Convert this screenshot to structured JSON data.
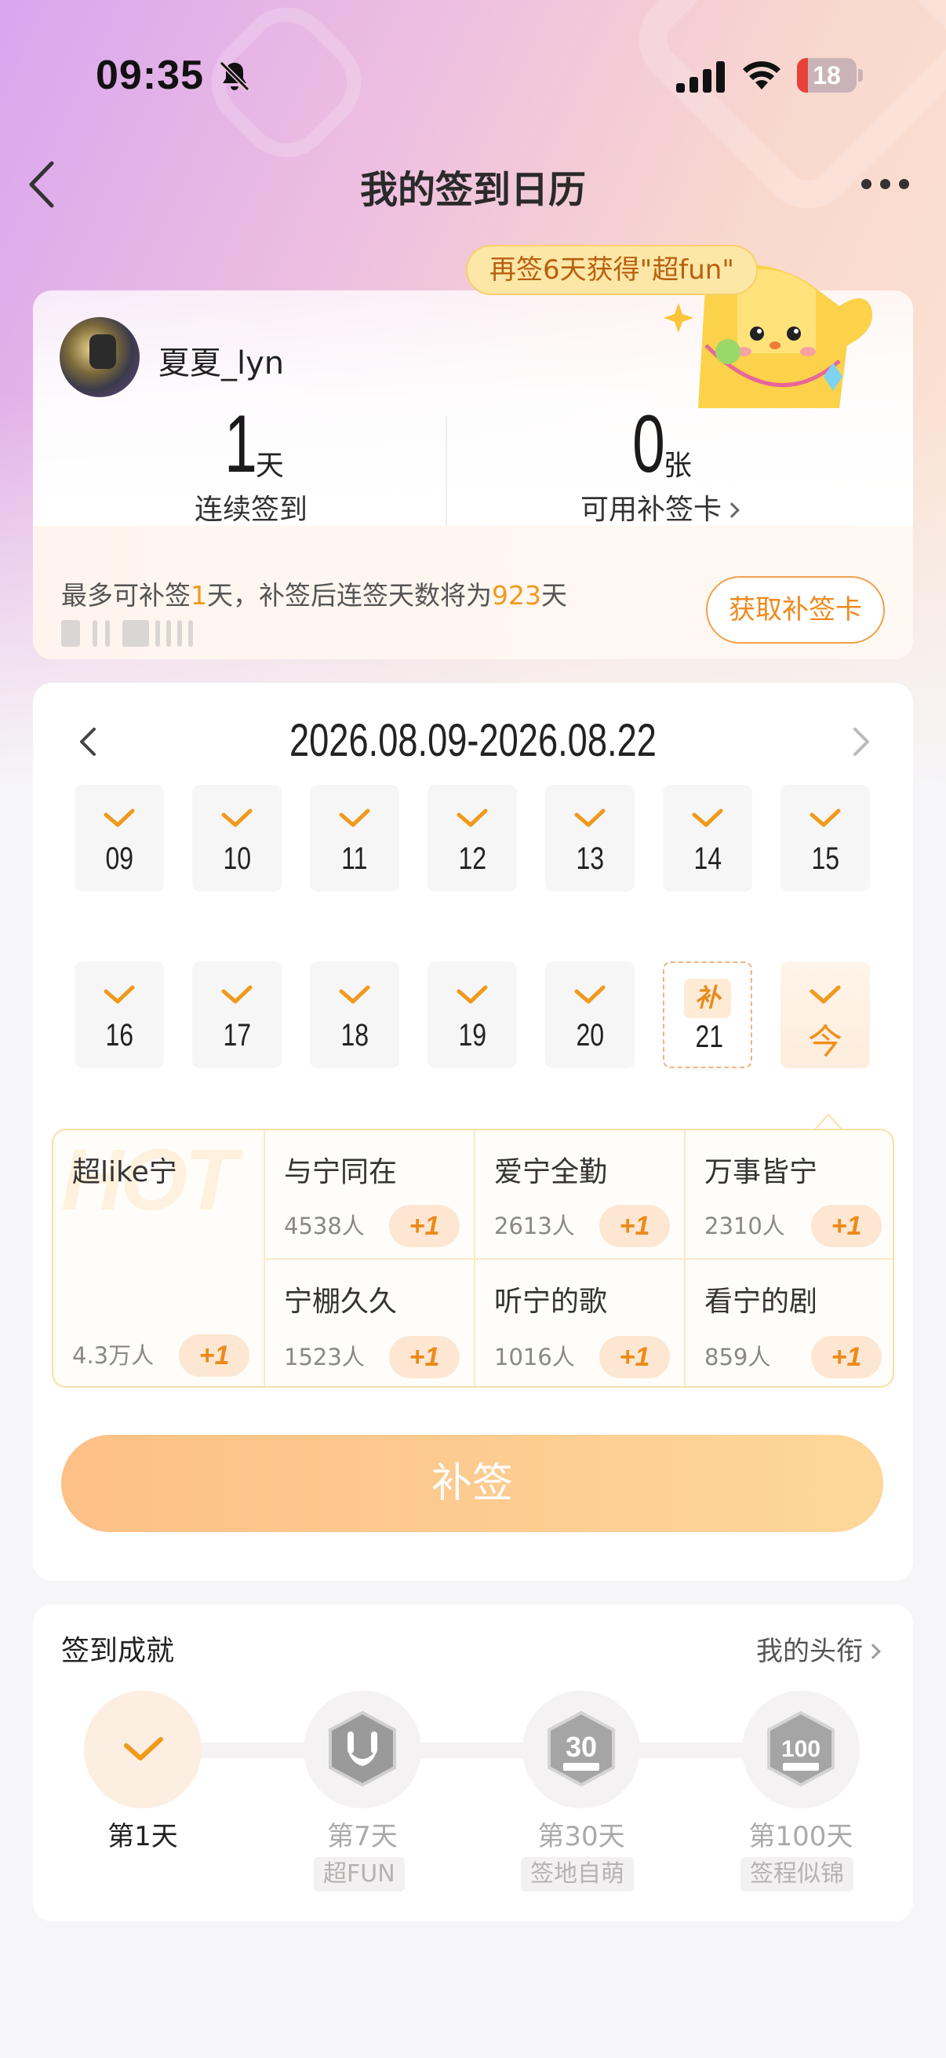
{
  "status_bar": {
    "time": "09:35",
    "battery": "18",
    "battery_level": 0.18
  },
  "nav": {
    "title": "我的签到日历"
  },
  "promo_bubble": "再签6天获得\"超fun\"",
  "profile": {
    "username": "夏夏_lyn"
  },
  "stats": {
    "streak_value": "1",
    "streak_unit": "天",
    "streak_label": "连续签到",
    "cards_value": "0",
    "cards_unit": "张",
    "cards_label": "可用补签卡"
  },
  "notice": {
    "prefix": "最多可补签",
    "days": "1",
    "middle": "天，补签后连签天数将为",
    "total": "923",
    "suffix": "天"
  },
  "get_card_button": "获取补签卡",
  "calendar": {
    "range": "2026.08.09-2026.08.22",
    "week1": [
      "09",
      "10",
      "11",
      "12",
      "13",
      "14",
      "15"
    ],
    "week2": [
      "16",
      "17",
      "18",
      "19",
      "20"
    ],
    "makeup_day": {
      "tag": "补",
      "num": "21"
    },
    "today_label": "今"
  },
  "topics": {
    "hot": {
      "title": "超like宁",
      "count": "4.3万人",
      "plus": "+1",
      "bg": "HOT"
    },
    "items": [
      {
        "title": "与宁同在",
        "count": "4538人",
        "plus": "+1"
      },
      {
        "title": "爱宁全勤",
        "count": "2613人",
        "plus": "+1"
      },
      {
        "title": "万事皆宁",
        "count": "2310人",
        "plus": "+1"
      },
      {
        "title": "宁棚久久",
        "count": "1523人",
        "plus": "+1"
      },
      {
        "title": "听宁的歌",
        "count": "1016人",
        "plus": "+1"
      },
      {
        "title": "看宁的剧",
        "count": "859人",
        "plus": "+1"
      }
    ]
  },
  "signin_button": "补签",
  "achievements": {
    "title": "签到成就",
    "link": "我的头衔",
    "milestones": [
      {
        "label": "第1天",
        "sub": ""
      },
      {
        "label": "第7天",
        "sub": "超FUN"
      },
      {
        "label": "第30天",
        "sub": "签地自萌"
      },
      {
        "label": "第100天",
        "sub": "签程似锦"
      }
    ]
  },
  "colors": {
    "accent": "#f09a1c",
    "button": "#fdc282"
  }
}
